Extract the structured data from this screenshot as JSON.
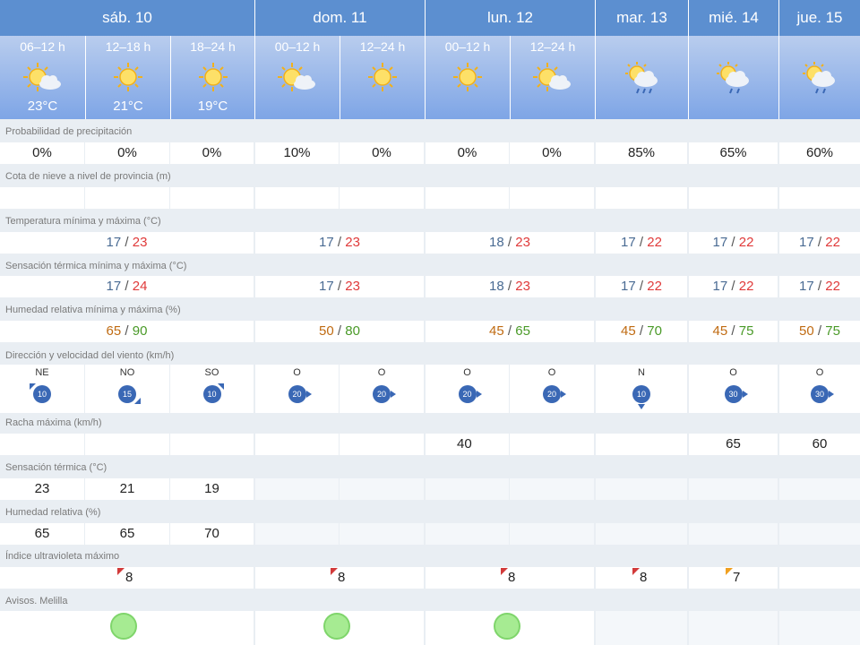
{
  "days": [
    "sáb. 10",
    "dom. 11",
    "lun. 12",
    "mar. 13",
    "mié. 14",
    "jue. 15"
  ],
  "periods": [
    {
      "label": "06–12 h",
      "temp": "23°C",
      "icon": "sun-partly-cloudy-icon"
    },
    {
      "label": "12–18 h",
      "temp": "21°C",
      "icon": "sun-icon"
    },
    {
      "label": "18–24 h",
      "temp": "19°C",
      "icon": "sun-icon"
    },
    {
      "label": "00–12 h",
      "temp": "",
      "icon": "sun-partly-cloudy-icon"
    },
    {
      "label": "12–24 h",
      "temp": "",
      "icon": "sun-icon"
    },
    {
      "label": "00–12 h",
      "temp": "",
      "icon": "sun-icon"
    },
    {
      "label": "12–24 h",
      "temp": "",
      "icon": "sun-partly-cloudy-icon"
    },
    {
      "label": "",
      "temp": "",
      "icon": "sun-cloud-rain-icon"
    },
    {
      "label": "",
      "temp": "",
      "icon": "sun-cloud-rain-icon"
    },
    {
      "label": "",
      "temp": "",
      "icon": "sun-cloud-rain-icon"
    }
  ],
  "sections": {
    "precip_title": "Probabilidad de precipitación",
    "snow_title": "Cota de nieve a nivel de provincia (m)",
    "temp_title": "Temperatura mínima y máxima (°C)",
    "feels_title": "Sensación térmica mínima y máxima (°C)",
    "hum_title": "Humedad relativa mínima y máxima (%)",
    "wind_title": "Dirección y velocidad del viento (km/h)",
    "gust_title": "Racha máxima (km/h)",
    "feels_period_title": "Sensación térmica (°C)",
    "hum_period_title": "Humedad relativa (%)",
    "uv_title": "Índice ultravioleta máximo",
    "alerts_title": "Avisos. Melilla"
  },
  "precip": [
    "0%",
    "0%",
    "0%",
    "10%",
    "0%",
    "0%",
    "0%",
    "85%",
    "65%",
    "60%"
  ],
  "temp_minmax": [
    {
      "min": "17",
      "max": "23"
    },
    {
      "min": "17",
      "max": "23"
    },
    {
      "min": "18",
      "max": "23"
    },
    {
      "min": "17",
      "max": "22"
    },
    {
      "min": "17",
      "max": "22"
    },
    {
      "min": "17",
      "max": "22"
    }
  ],
  "feels_minmax": [
    {
      "min": "17",
      "max": "24"
    },
    {
      "min": "17",
      "max": "23"
    },
    {
      "min": "18",
      "max": "23"
    },
    {
      "min": "17",
      "max": "22"
    },
    {
      "min": "17",
      "max": "22"
    },
    {
      "min": "17",
      "max": "22"
    }
  ],
  "hum_minmax": [
    {
      "min": "65",
      "max": "90"
    },
    {
      "min": "50",
      "max": "80"
    },
    {
      "min": "45",
      "max": "65"
    },
    {
      "min": "45",
      "max": "70"
    },
    {
      "min": "45",
      "max": "75"
    },
    {
      "min": "50",
      "max": "75"
    }
  ],
  "wind": [
    {
      "dir": "NE",
      "speed": "10"
    },
    {
      "dir": "NO",
      "speed": "15"
    },
    {
      "dir": "SO",
      "speed": "10"
    },
    {
      "dir": "O",
      "speed": "20"
    },
    {
      "dir": "O",
      "speed": "20"
    },
    {
      "dir": "O",
      "speed": "20"
    },
    {
      "dir": "O",
      "speed": "20"
    },
    {
      "dir": "N",
      "speed": "10"
    },
    {
      "dir": "O",
      "speed": "30"
    },
    {
      "dir": "O",
      "speed": "30"
    }
  ],
  "gust": [
    "",
    "",
    "",
    "",
    "",
    "40",
    "",
    "",
    "65",
    "60"
  ],
  "feels_period": [
    "23",
    "21",
    "19"
  ],
  "hum_period": [
    "65",
    "65",
    "70"
  ],
  "uv": [
    "8",
    "8",
    "8",
    "8",
    "7"
  ],
  "colors": {
    "header": "#5c8fd0",
    "uv_red": "#d23a3a",
    "uv_orange": "#f0a020",
    "alert_green": "#a6eb92"
  }
}
